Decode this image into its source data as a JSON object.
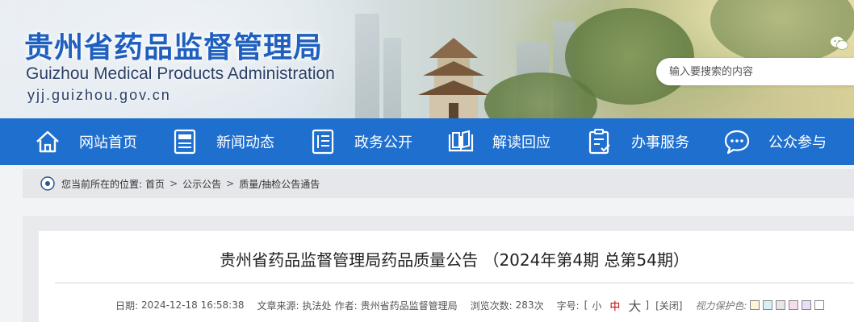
{
  "header": {
    "title_cn": "贵州省药品监督管理局",
    "title_en": "Guizhou Medical Products Administration",
    "url": "yjj.guizhou.gov.cn",
    "search_placeholder": "输入要搜索的内容",
    "wechat_icon": "wechat-icon"
  },
  "nav": {
    "items": [
      {
        "label": "网站首页",
        "icon": "home-icon"
      },
      {
        "label": "新闻动态",
        "icon": "newspaper-icon"
      },
      {
        "label": "政务公开",
        "icon": "document-icon"
      },
      {
        "label": "解读回应",
        "icon": "open-book-icon"
      },
      {
        "label": "办事服务",
        "icon": "service-icon"
      },
      {
        "label": "公众参与",
        "icon": "chat-bubble-icon"
      }
    ]
  },
  "breadcrumb": {
    "prefix": "您当前所在的位置:",
    "items": [
      "首页",
      "公示公告",
      "质量/抽检公告通告"
    ],
    "separator": ">"
  },
  "article": {
    "title": "贵州省药品监督管理局药品质量公告 （2024年第4期 总第54期）",
    "date_label": "日期:",
    "date": "2024-12-18 16:58:38",
    "source_label": "文章来源:",
    "source": "执法处",
    "author_label": "作者:",
    "author": "贵州省药品监督管理局",
    "views_label": "浏览次数:",
    "views": "283",
    "views_unit": "次",
    "fontsize_label": "字号:",
    "bracket_open": "[",
    "bracket_close": "]",
    "size_small": "小",
    "size_medium": "中",
    "size_large": "大",
    "close_label": "[关闭]",
    "protect_label": "视力保护色:",
    "swatch_colors": [
      "#fbf6d8",
      "#d6f0f7",
      "#e6e6e6",
      "#f4ddec",
      "#e8dcf6",
      "#ffffff"
    ]
  },
  "colors": {
    "nav_bg": "#1f6fcf",
    "title_blue": "#1f5fbf",
    "size_medium_red": "#cc0000"
  }
}
